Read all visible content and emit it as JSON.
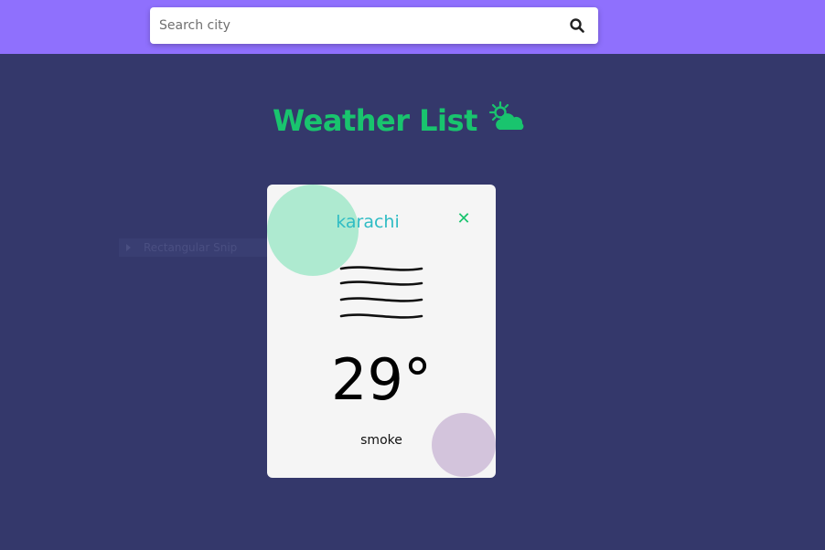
{
  "search": {
    "placeholder": "Search city",
    "value": "",
    "button_icon": "search-icon"
  },
  "header": {
    "title": "Weather List",
    "title_icon": "sun-cloud-icon"
  },
  "background_hint": {
    "label": "Rectangular Snip"
  },
  "card": {
    "city": "karachi",
    "close_icon": "close-icon",
    "condition_icon": "haze-icon",
    "temperature": "29°",
    "description": "smoke"
  },
  "colors": {
    "topbar": "#8f70fd",
    "background": "#34386b",
    "accent_green": "#19c46e",
    "city_text": "#2fbcc4",
    "card": "#f5f5f5"
  }
}
